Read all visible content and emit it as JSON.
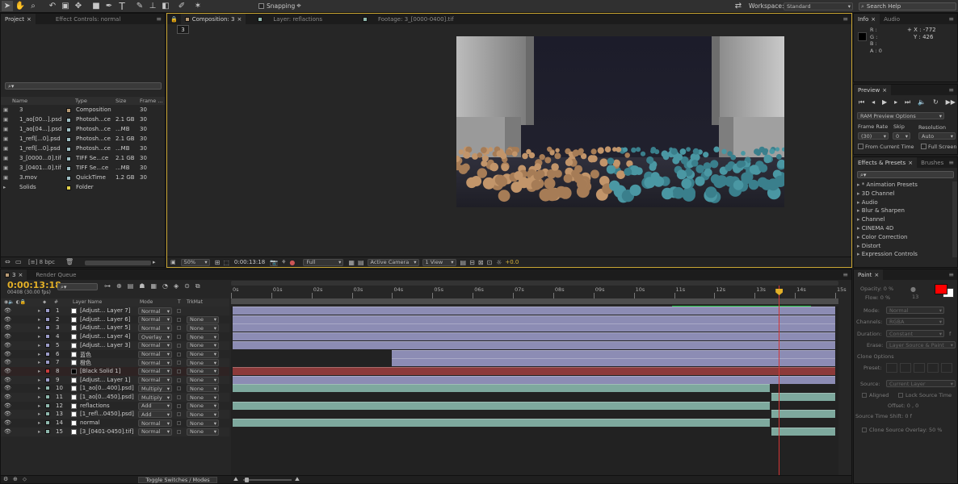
{
  "toolbar": {
    "snapping_label": "Snapping",
    "workspace_label": "Workspace:",
    "workspace_value": "Standard",
    "search_placeholder": "Search Help"
  },
  "project": {
    "tabs": [
      "Project",
      "Effect Controls: normal"
    ],
    "columns": {
      "name": "Name",
      "type": "Type",
      "size": "Size",
      "frame": "Frame ..."
    },
    "items": [
      {
        "name": "3",
        "type": "Composition",
        "size": "",
        "frame": "30",
        "color": "#b89a74"
      },
      {
        "name": "1_ao[00...].psd",
        "type": "Photosh...ce",
        "size": "2.1 GB",
        "frame": "30",
        "color": "#9fbfc4"
      },
      {
        "name": "1_ao[04...].psd",
        "type": "Photosh...ce",
        "size": "...MB",
        "frame": "30",
        "color": "#9fbfc4"
      },
      {
        "name": "1_refl[...0].psd",
        "type": "Photosh...ce",
        "size": "2.1 GB",
        "frame": "30",
        "color": "#9fbfc4"
      },
      {
        "name": "1_refl[...0].psd",
        "type": "Photosh...ce",
        "size": "...MB",
        "frame": "30",
        "color": "#9fbfc4"
      },
      {
        "name": "3_[0000...0].tif",
        "type": "TIFF Se...ce",
        "size": "2.1 GB",
        "frame": "30",
        "color": "#9fbfc4"
      },
      {
        "name": "3_[0401...0].tif",
        "type": "TIFF Se...ce",
        "size": "...MB",
        "frame": "30",
        "color": "#9fbfc4"
      },
      {
        "name": "3.mov",
        "type": "QuickTime",
        "size": "1.2 GB",
        "frame": "30",
        "color": "#9fbfc4"
      },
      {
        "name": "Solids",
        "type": "Folder",
        "size": "",
        "frame": "",
        "color": "#e3d24a"
      }
    ],
    "footer_bpc": "8 bpc"
  },
  "viewer": {
    "tabs": [
      "Composition: 3",
      "Layer: reflactions",
      "Footage: 3_[0000-0400].tif"
    ],
    "comp_chip": "3",
    "zoom": "50%",
    "timecode": "0:00:13:18",
    "resolution": "Full",
    "camera": "Active Camera",
    "view": "1 View",
    "exposure": "+0.0"
  },
  "info": {
    "tabs": [
      "Info",
      "Audio"
    ],
    "r": "R :",
    "g": "G :",
    "b": "B :",
    "a": "A : 0",
    "x": "X : -772",
    "y": "Y : 426"
  },
  "preview": {
    "tab": "Preview",
    "ram_options": "RAM Preview Options",
    "frame_rate_label": "Frame Rate",
    "skip_label": "Skip",
    "resolution_label": "Resolution",
    "frame_rate_value": "(30)",
    "skip_value": "0",
    "resolution_value": "Auto",
    "from_current": "From Current Time",
    "full_screen": "Full Screen"
  },
  "effects": {
    "tabs": [
      "Effects & Presets",
      "Brushes"
    ],
    "items": [
      "* Animation Presets",
      "3D Channel",
      "Audio",
      "Blur & Sharpen",
      "Channel",
      "CINEMA 4D",
      "Color Correction",
      "Distort",
      "Expression Controls"
    ]
  },
  "paint": {
    "tab": "Paint",
    "opacity": "Opacity: 0 %",
    "flow": "Flow: 0 %",
    "brush_size": "13",
    "mode_label": "Mode:",
    "mode_value": "Normal",
    "channels_label": "Channels:",
    "channels_value": "RGBA",
    "duration_label": "Duration:",
    "duration_value": "Constant",
    "duration_f": "f",
    "erase_label": "Erase:",
    "erase_value": "Layer Source & Paint",
    "clone_options": "Clone Options",
    "preset_label": "Preset:",
    "source_label": "Source:",
    "source_value": "Current Layer",
    "aligned": "Aligned",
    "lock_source": "Lock Source Time",
    "offset": "Offset: 0 , 0",
    "shift": "Source Time Shift: 0 f",
    "overlay": "Clone Source Overlay: 50 %",
    "fg_color": "#ff0000",
    "bg_color": "#ffffff"
  },
  "timeline": {
    "tabs": [
      "3",
      "Render Queue"
    ],
    "timecode": "0:00:13:18",
    "frame_info": "00408 (30.00 fps)",
    "columns": {
      "num": "#",
      "name": "Layer Name",
      "mode": "Mode",
      "t": "T",
      "trkmat": "TrkMat"
    },
    "ruler": [
      "0s",
      "01s",
      "02s",
      "03s",
      "04s",
      "05s",
      "06s",
      "07s",
      "08s",
      "09s",
      "10s",
      "11s",
      "12s",
      "13s",
      "14s",
      "15s"
    ],
    "layers": [
      {
        "num": "1",
        "name": "[Adjust... Layer 7]",
        "mode": "Normal",
        "trkmat": "",
        "label": "#9b9bc8",
        "start": 0,
        "end": 15
      },
      {
        "num": "2",
        "name": "[Adjust... Layer 6]",
        "mode": "Normal",
        "trkmat": "None",
        "label": "#9b9bc8",
        "start": 0,
        "end": 15
      },
      {
        "num": "3",
        "name": "[Adjust... Layer 5]",
        "mode": "Normal",
        "trkmat": "None",
        "label": "#9b9bc8",
        "start": 0,
        "end": 15
      },
      {
        "num": "4",
        "name": "[Adjust... Layer 4]",
        "mode": "Overlay",
        "trkmat": "None",
        "label": "#9b9bc8",
        "start": 0,
        "end": 15
      },
      {
        "num": "5",
        "name": "[Adjust... Layer 3]",
        "mode": "Normal",
        "trkmat": "None",
        "label": "#9b9bc8",
        "start": 0,
        "end": 15
      },
      {
        "num": "6",
        "name": "蓝色",
        "mode": "Normal",
        "trkmat": "None",
        "label": "#9b9bc8",
        "start": 3.95,
        "end": 15
      },
      {
        "num": "7",
        "name": "橙色",
        "mode": "Normal",
        "trkmat": "None",
        "label": "#9b9bc8",
        "start": 3.95,
        "end": 15
      },
      {
        "num": "8",
        "name": "[Black Solid 1]",
        "mode": "Normal",
        "trkmat": "None",
        "label": "#c83c3c",
        "start": 0,
        "end": 15
      },
      {
        "num": "9",
        "name": "[Adjust... Layer 1]",
        "mode": "Normal",
        "trkmat": "None",
        "label": "#9b9bc8",
        "start": 0,
        "end": 15
      },
      {
        "num": "10",
        "name": "[1_ao[0...400].psd]",
        "mode": "Multiply",
        "trkmat": "None",
        "label": "#8fb8ad",
        "start": 0,
        "end": 13.37
      },
      {
        "num": "11",
        "name": "[1_ao[0...450].psd]",
        "mode": "Multiply",
        "trkmat": "None",
        "label": "#8fb8ad",
        "start": 13.37,
        "end": 15
      },
      {
        "num": "12",
        "name": "reflactions",
        "mode": "Add",
        "trkmat": "None",
        "label": "#8fb8ad",
        "start": 0,
        "end": 13.37
      },
      {
        "num": "13",
        "name": "[1_refl...0450].psd]",
        "mode": "Add",
        "trkmat": "None",
        "label": "#8fb8ad",
        "start": 13.37,
        "end": 15
      },
      {
        "num": "14",
        "name": "normal",
        "mode": "Normal",
        "trkmat": "None",
        "label": "#8fb8ad",
        "start": 0,
        "end": 13.37
      },
      {
        "num": "15",
        "name": "[3_[0401-0450].tif]",
        "mode": "Normal",
        "trkmat": "None",
        "label": "#8fb8ad",
        "start": 13.37,
        "end": 15
      }
    ],
    "playhead_seconds": 13.6,
    "toggle_label": "Toggle Switches / Modes"
  }
}
